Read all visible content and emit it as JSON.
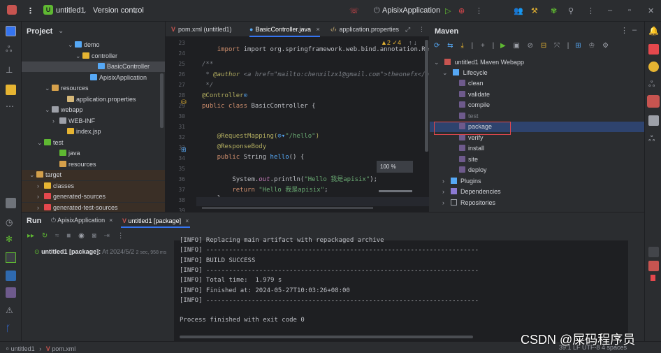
{
  "titlebar": {
    "project_badge": "U",
    "project_name": "untitled1",
    "version_control": "Version control",
    "run_config": "ApisixApplication"
  },
  "project_panel": {
    "title": "Project",
    "items": [
      {
        "label": "demo",
        "indent": 6,
        "arrow": "⌄"
      },
      {
        "label": "controller",
        "indent": 7,
        "arrow": "⌄"
      },
      {
        "label": "BasicController",
        "indent": 9,
        "arrow": ""
      },
      {
        "label": "ApisixApplication",
        "indent": 8,
        "arrow": ""
      },
      {
        "label": "resources",
        "indent": 3,
        "arrow": "⌄"
      },
      {
        "label": "application.properties",
        "indent": 5,
        "arrow": ""
      },
      {
        "label": "webapp",
        "indent": 3,
        "arrow": "⌄"
      },
      {
        "label": "WEB-INF",
        "indent": 4,
        "arrow": "›"
      },
      {
        "label": "index.jsp",
        "indent": 5,
        "arrow": ""
      },
      {
        "label": "test",
        "indent": 2,
        "arrow": "⌄"
      },
      {
        "label": "java",
        "indent": 4,
        "arrow": ""
      },
      {
        "label": "resources",
        "indent": 4,
        "arrow": ""
      },
      {
        "label": "target",
        "indent": 1,
        "arrow": "⌄"
      },
      {
        "label": "classes",
        "indent": 2,
        "arrow": "›"
      },
      {
        "label": "generated-sources",
        "indent": 2,
        "arrow": "›"
      },
      {
        "label": "generated-test-sources",
        "indent": 2,
        "arrow": "›"
      }
    ]
  },
  "editor": {
    "tabs": [
      "pom.xml (untitled1)",
      "BasicController.java",
      "application.properties"
    ],
    "inspection": "▲2  ✓4",
    "zoom": "100 %",
    "line_numbers": [
      "23",
      "24",
      "25",
      "26",
      "27",
      "28",
      "29",
      "30",
      "31",
      "32",
      "33",
      "34",
      "35",
      "36",
      "37",
      "38",
      "39"
    ],
    "lines": {
      "l23": "import org.springframework.web.bind.annotation.Re",
      "l25": "/**",
      "l26a": " * ",
      "l26b": "@author",
      "l26c": " <a href=\"mailto:chenxilzx1@gmail.com\">theonefx</a>",
      "l27": " */",
      "l28a": "@Controller",
      "l29a": "public class ",
      "l29b": "BasicController {",
      "l32a": "    @RequestMapping(",
      "l32b": "\"/hello\"",
      "l32c": ")",
      "l33": "    @ResponseBody",
      "l34a": "    public ",
      "l34b": "String ",
      "l34c": "hello",
      "l34d": "() {",
      "l36a": "        System.",
      "l36b": "out",
      "l36c": ".println(",
      "l36d": "\"Hello 我是apisix\"",
      "l36e": ");",
      "l37a": "        return ",
      "l37b": "\"Hello 我是apisix\"",
      "l37c": ";",
      "l38": "    }"
    }
  },
  "maven": {
    "title": "Maven",
    "project": "untitled1 Maven Webapp",
    "lifecycle": "Lifecycle",
    "goals": [
      "clean",
      "validate",
      "compile",
      "test",
      "package",
      "verify",
      "install",
      "site",
      "deploy"
    ],
    "plugins": "Plugins",
    "dependencies": "Dependencies",
    "repositories": "Repositories"
  },
  "run": {
    "title": "Run",
    "tabs": [
      "ApisixApplication",
      "untitled1 [package]"
    ],
    "history_label": "untitled1 [package]:",
    "history_time": "At 2024/5/2",
    "history_duration": "2 sec, 958 ms",
    "console": [
      "[INFO] Replacing main artifact with repackaged archive",
      "[INFO] ------------------------------------------------------------------------",
      "[INFO] BUILD SUCCESS",
      "[INFO] ------------------------------------------------------------------------",
      "[INFO] Total time:  1.979 s",
      "[INFO] Finished at: 2024-05-27T10:03:26+08:00",
      "[INFO] ------------------------------------------------------------------------",
      "",
      "Process finished with exit code 0"
    ]
  },
  "statusbar": {
    "crumb1": "untitled1",
    "crumb2": "pom.xml",
    "right": "39:1   LF   UTF-8   4 spaces"
  },
  "watermark": "CSDN @屎码程序员",
  "colors": {
    "accent": "#3574f0",
    "selection_highlight": "#e5484d",
    "success_icon": "#5fb832"
  }
}
